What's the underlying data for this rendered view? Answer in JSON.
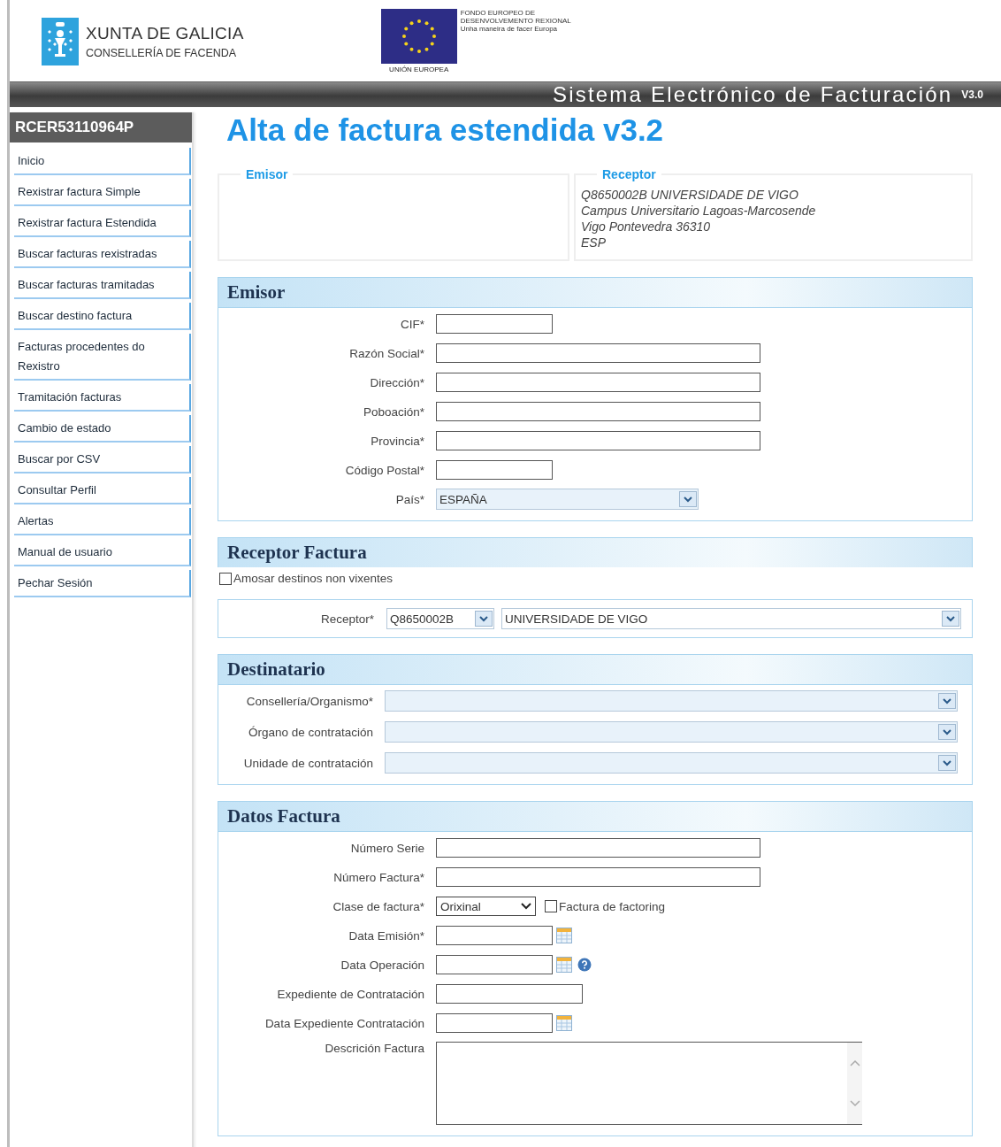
{
  "header": {
    "org_name": "XUNTA DE GALICIA",
    "department": "CONSELLERÍA DE FACENDA",
    "eu_fund": [
      "FONDO EUROPEO DE",
      "DESENVOLVEMENTO REXIONAL",
      "Unha maneira de facer Europa"
    ],
    "eu_caption": "UNIÓN EUROPEA"
  },
  "banner": {
    "title": "Sistema Electrónico de Facturación",
    "version": "V3.0"
  },
  "sidebar": {
    "user": "RCER53110964P",
    "items": [
      {
        "label": "Inicio"
      },
      {
        "label": "Rexistrar factura Simple"
      },
      {
        "label": "Rexistrar factura Estendida"
      },
      {
        "label": "Buscar facturas rexistradas"
      },
      {
        "label": "Buscar facturas tramitadas"
      },
      {
        "label": "Buscar destino factura"
      },
      {
        "label": "Facturas procedentes do Rexistro"
      },
      {
        "label": "Tramitación facturas"
      },
      {
        "label": "Cambio de estado"
      },
      {
        "label": "Buscar por CSV"
      },
      {
        "label": "Consultar Perfil"
      },
      {
        "label": "Alertas"
      },
      {
        "label": "Manual de usuario"
      },
      {
        "label": "Pechar Sesión"
      }
    ]
  },
  "page_title": "Alta de factura estendida v3.2",
  "summary": [
    {
      "legend": "Emisor"
    },
    {
      "legend": "Receptor",
      "lines": [
        "Q8650002B  UNIVERSIDADE DE VIGO",
        "Campus Universitario Lagoas-Marcosende",
        "Vigo Pontevedra 36310",
        "ESP"
      ]
    }
  ],
  "sections": [
    {
      "kind": "form",
      "title": "Emisor",
      "fields": [
        {
          "label": "CIF*",
          "kind": "short_text"
        },
        {
          "label": "Razón Social*",
          "kind": "long_text"
        },
        {
          "label": "Dirección*",
          "kind": "long_text"
        },
        {
          "label": "Poboación*",
          "kind": "long_text"
        },
        {
          "label": "Provincia*",
          "kind": "long_text"
        },
        {
          "label": "Código Postal*",
          "kind": "short_text"
        },
        {
          "label": "País*",
          "kind": "short_combo",
          "value": "ESPAÑA",
          "disabled": true
        }
      ]
    },
    {
      "kind": "receptor",
      "title": "Receptor Factura",
      "option": {
        "label": "Amosar destinos non vixentes",
        "checked": false
      },
      "row": {
        "label": "Receptor*",
        "code": "Q8650002B",
        "name": "UNIVERSIDADE DE VIGO"
      }
    },
    {
      "kind": "selects",
      "title": "Destinatario",
      "fields": [
        {
          "label": "Consellería/Organismo*",
          "kind": "combo",
          "disabled": true
        },
        {
          "label": "Órgano de contratación",
          "kind": "combo",
          "disabled": true
        },
        {
          "label": "Unidade de contratación",
          "kind": "combo",
          "disabled": true
        }
      ]
    },
    {
      "kind": "form",
      "title": "Datos Factura",
      "fields": [
        {
          "label": "Número Serie",
          "kind": "long_text"
        },
        {
          "label": "Número Factura*",
          "kind": "long_text"
        },
        {
          "label": "Clase de factura*",
          "kind": "select",
          "value": "Orixinal",
          "checkbox": {
            "label": "Factura de factoring",
            "checked": false
          }
        },
        {
          "label": "Data Emisión*",
          "kind": "date",
          "help": false
        },
        {
          "label": "Data Operación",
          "kind": "date",
          "help": true
        },
        {
          "label": "Expediente de Contratación",
          "kind": "medium_text"
        },
        {
          "label": "Data Expediente Contratación",
          "kind": "date",
          "help": false
        },
        {
          "label": "Descrición Factura",
          "kind": "textarea"
        }
      ]
    }
  ]
}
